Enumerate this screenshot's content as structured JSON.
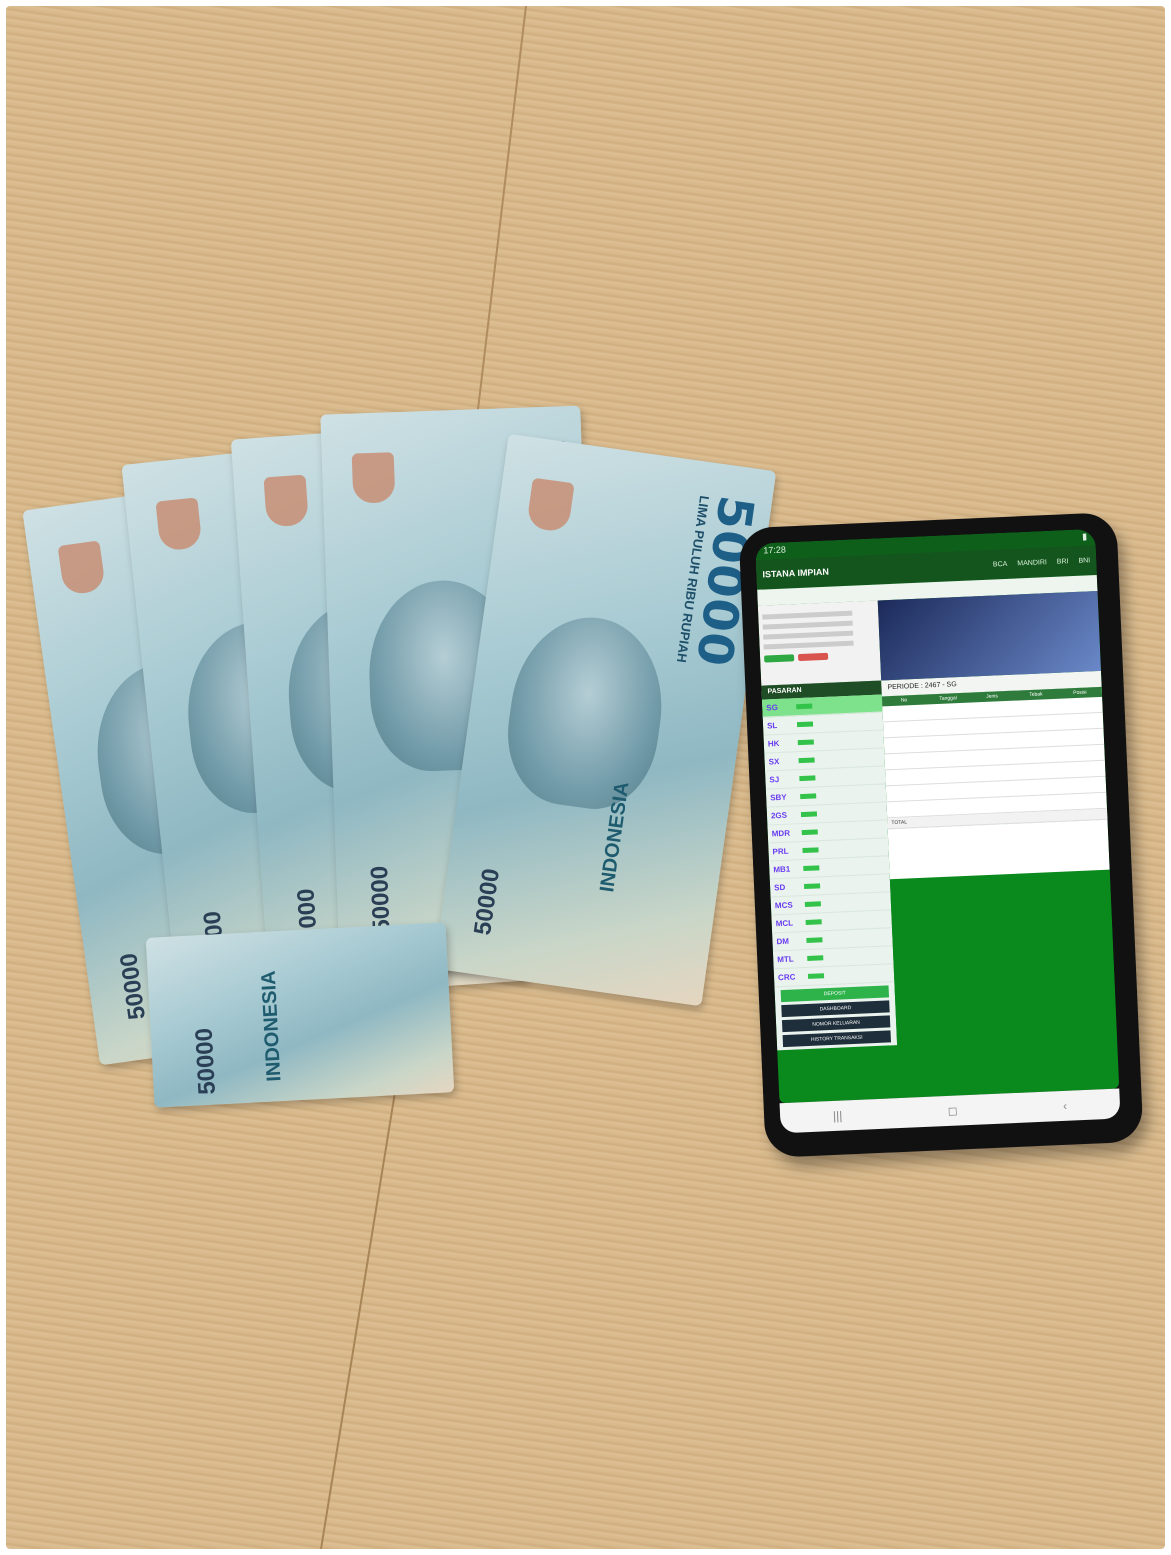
{
  "scene": {
    "description_label": "Photo",
    "banknote_value": "50000",
    "banknote_words": "LIMA PULUH RIBU RUPIAH",
    "banknote_country": "INDONESIA"
  },
  "phone": {
    "status_time": "17:28",
    "site_name": "ISTANA IMPIAN",
    "nav": [
      "BCA",
      "MANDIRI",
      "BRI",
      "BNI"
    ],
    "pasaran_header": "PASARAN",
    "markets": [
      "SG",
      "SL",
      "HK",
      "SX",
      "SJ",
      "SBY",
      "2GS",
      "MDR",
      "PRL",
      "MB1",
      "SD",
      "MCS",
      "MCL",
      "DM",
      "MTL",
      "CRC"
    ],
    "periode": "PERIODE : 2467 - SG",
    "side_buttons": [
      "DEPOSIT",
      "DASHBOARD",
      "NOMOR KELUARAN",
      "HISTORY TRANSAKSI"
    ],
    "table_headers": [
      "No",
      "Tanggal",
      "Jenis",
      "Tebak",
      "Posisi"
    ],
    "total_label": "TOTAL"
  },
  "colors": {
    "site_green": "#0a8a1c",
    "market_purple": "#6a3df0",
    "bill_blue": "#1e5f88"
  }
}
